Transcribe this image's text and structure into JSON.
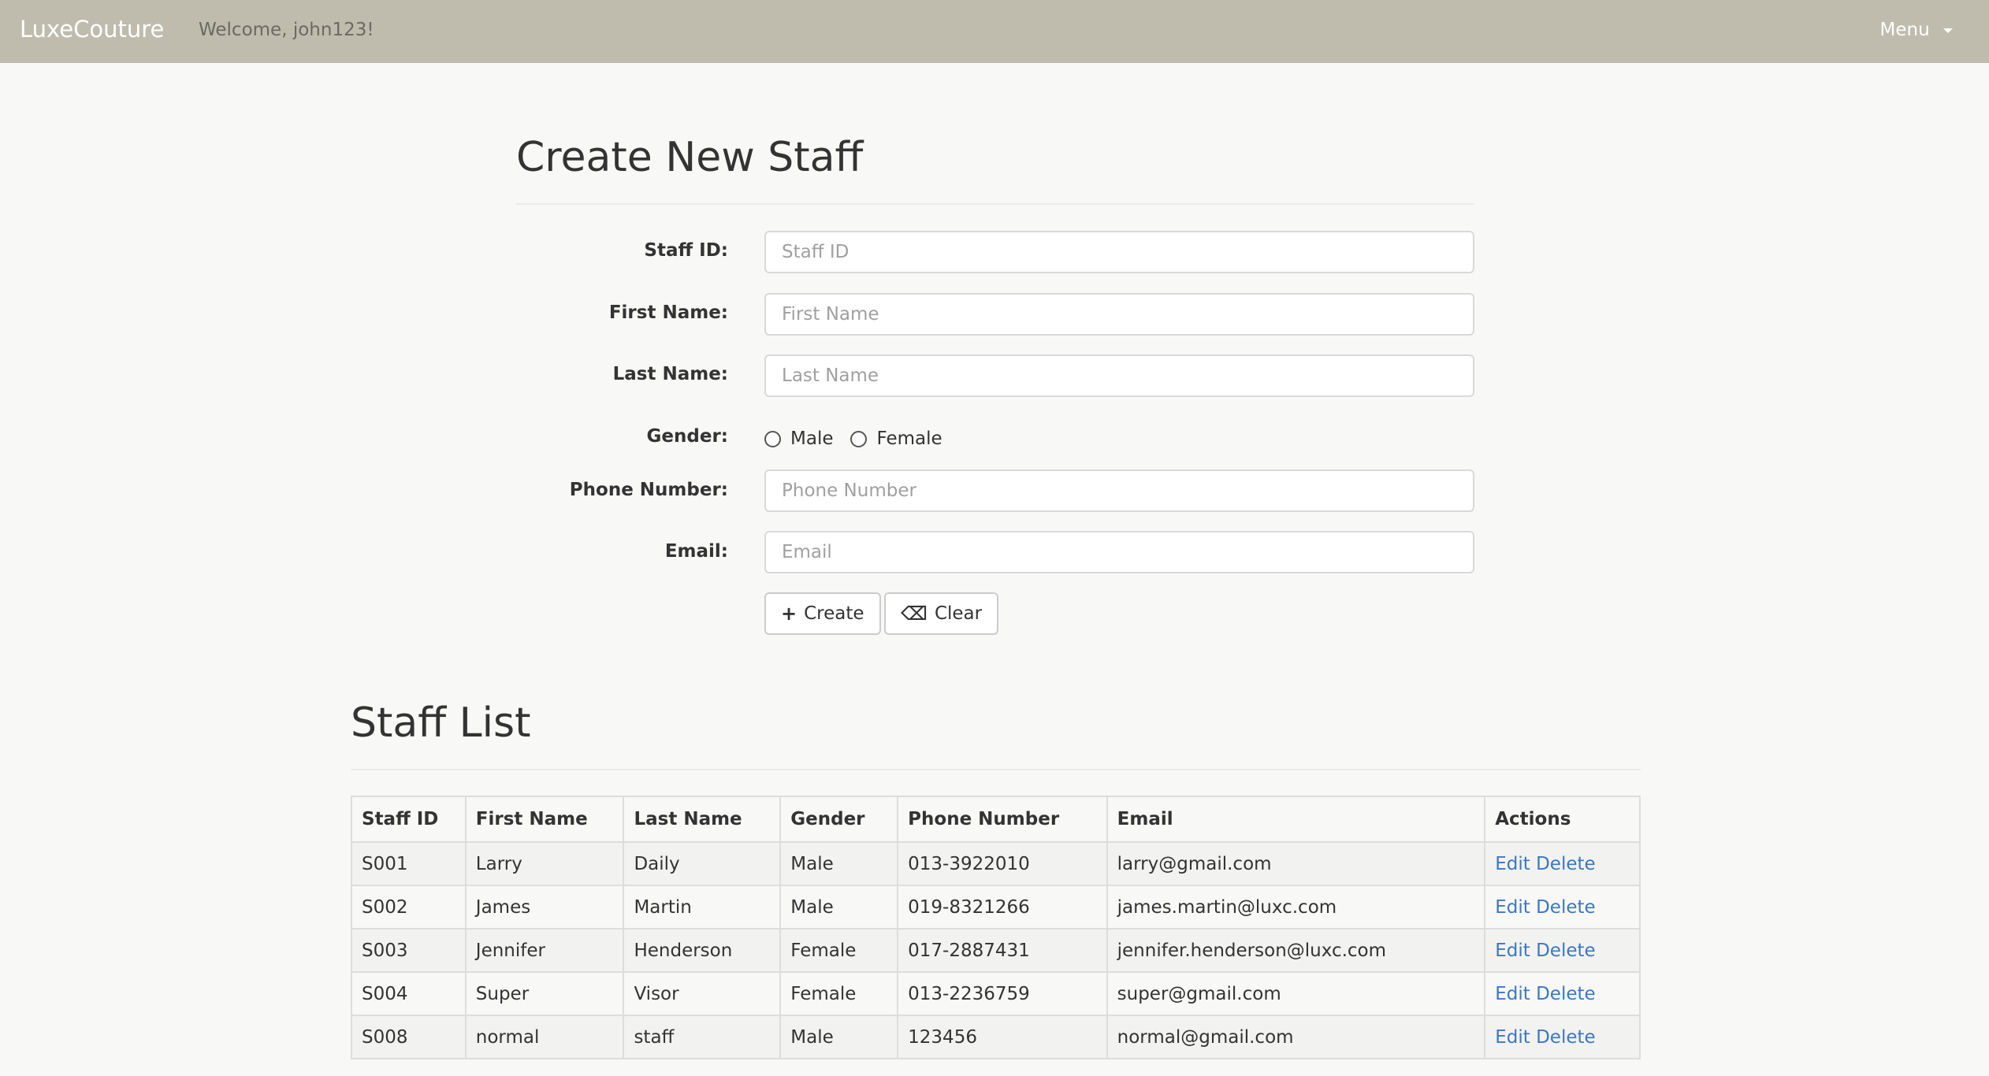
{
  "navbar": {
    "brand": "LuxeCouture",
    "welcome": "Welcome, john123!",
    "menu_label": "Menu",
    "background": "#bfbcae"
  },
  "create_form": {
    "title": "Create New Staff",
    "fields": {
      "staff_id": {
        "label": "Staff ID:",
        "placeholder": "Staff ID",
        "value": ""
      },
      "first_name": {
        "label": "First Name:",
        "placeholder": "First Name",
        "value": ""
      },
      "last_name": {
        "label": "Last Name:",
        "placeholder": "Last Name",
        "value": ""
      },
      "gender": {
        "label": "Gender:",
        "options": [
          "Male",
          "Female"
        ],
        "selected": null
      },
      "phone": {
        "label": "Phone Number:",
        "placeholder": "Phone Number",
        "value": ""
      },
      "email": {
        "label": "Email:",
        "placeholder": "Email",
        "value": ""
      }
    },
    "buttons": {
      "create_label": "Create",
      "create_icon": "plus-icon",
      "clear_label": "Clear",
      "clear_icon": "eraser-icon"
    }
  },
  "staff_list": {
    "title": "Staff List",
    "columns": [
      "Staff ID",
      "First Name",
      "Last Name",
      "Gender",
      "Phone Number",
      "Email",
      "Actions"
    ],
    "rows": [
      {
        "id": "S001",
        "first": "Larry",
        "last": "Daily",
        "gender": "Male",
        "phone": "013-3922010",
        "email": "larry@gmail.com"
      },
      {
        "id": "S002",
        "first": "James",
        "last": "Martin",
        "gender": "Male",
        "phone": "019-8321266",
        "email": "james.martin@luxc.com"
      },
      {
        "id": "S003",
        "first": "Jennifer",
        "last": "Henderson",
        "gender": "Female",
        "phone": "017-2887431",
        "email": "jennifer.henderson@luxc.com"
      },
      {
        "id": "S004",
        "first": "Super",
        "last": "Visor",
        "gender": "Female",
        "phone": "013-2236759",
        "email": "super@gmail.com"
      },
      {
        "id": "S008",
        "first": "normal",
        "last": "staff",
        "gender": "Male",
        "phone": "123456",
        "email": "normal@gmail.com"
      }
    ],
    "edit_label": "Edit",
    "delete_label": "Delete",
    "link_color": "#3b78c1"
  }
}
